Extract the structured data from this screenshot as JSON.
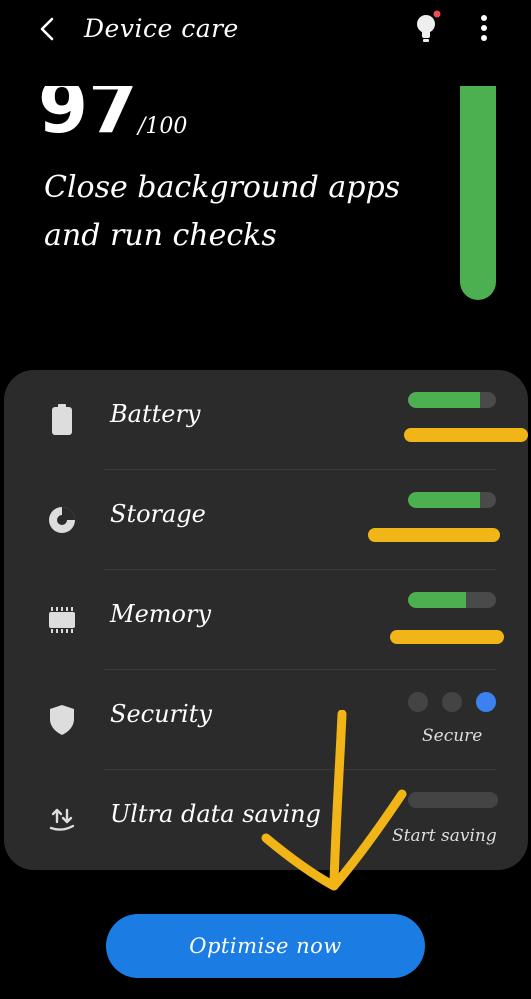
{
  "header": {
    "title": "Device care",
    "back_icon": "back-arrow-icon",
    "bulb_icon": "lightbulb-icon",
    "more_icon": "more-vert-icon"
  },
  "score": {
    "value": "97",
    "max": "/100"
  },
  "headline": "Close background apps and run checks",
  "gauge": {
    "level": 1.0,
    "color": "#4caf50"
  },
  "items": [
    {
      "label": "Battery",
      "icon": "battery-icon",
      "fill": 0.82
    },
    {
      "label": "Storage",
      "icon": "storage-pie-icon",
      "fill": 0.82
    },
    {
      "label": "Memory",
      "icon": "memory-chip-icon",
      "fill": 0.66
    },
    {
      "label": "Security",
      "icon": "shield-icon",
      "status": "Secure"
    },
    {
      "label": "Ultra data saving",
      "icon": "data-saving-icon",
      "status": "Start saving"
    }
  ],
  "button": {
    "label": "Optimise now"
  },
  "colors": {
    "accent_green": "#4caf50",
    "accent_blue": "#1b7de4",
    "redaction": "#f2b517"
  }
}
